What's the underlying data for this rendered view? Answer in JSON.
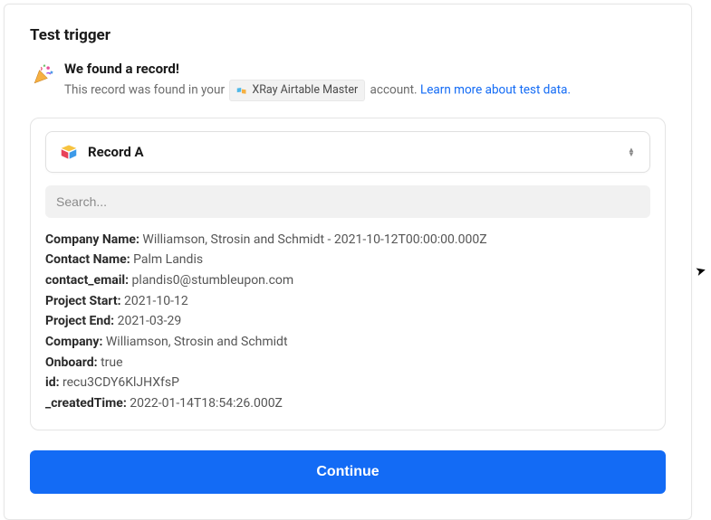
{
  "title": "Test trigger",
  "found": {
    "heading": "We found a record!",
    "sub_prefix": "This record was found in your",
    "account_name": "XRay Airtable Master",
    "sub_suffix": "account.",
    "learn_more": "Learn more about test data."
  },
  "record": {
    "name": "Record A",
    "search_placeholder": "Search..."
  },
  "fields": [
    {
      "label": "Company Name:",
      "value": "Williamson, Strosin and Schmidt - 2021-10-12T00:00:00.000Z"
    },
    {
      "label": "Contact Name:",
      "value": "Palm Landis"
    },
    {
      "label": "contact_email:",
      "value": "plandis0@stumbleupon.com"
    },
    {
      "label": "Project Start:",
      "value": "2021-10-12"
    },
    {
      "label": "Project End:",
      "value": "2021-03-29"
    },
    {
      "label": "Company:",
      "value": "Williamson, Strosin and Schmidt"
    },
    {
      "label": "Onboard:",
      "value": "true"
    },
    {
      "label": "id:",
      "value": "recu3CDY6KlJHXfsP"
    },
    {
      "label": "_createdTime:",
      "value": "2022-01-14T18:54:26.000Z"
    }
  ],
  "continue_label": "Continue",
  "colors": {
    "primary": "#136bf5"
  }
}
